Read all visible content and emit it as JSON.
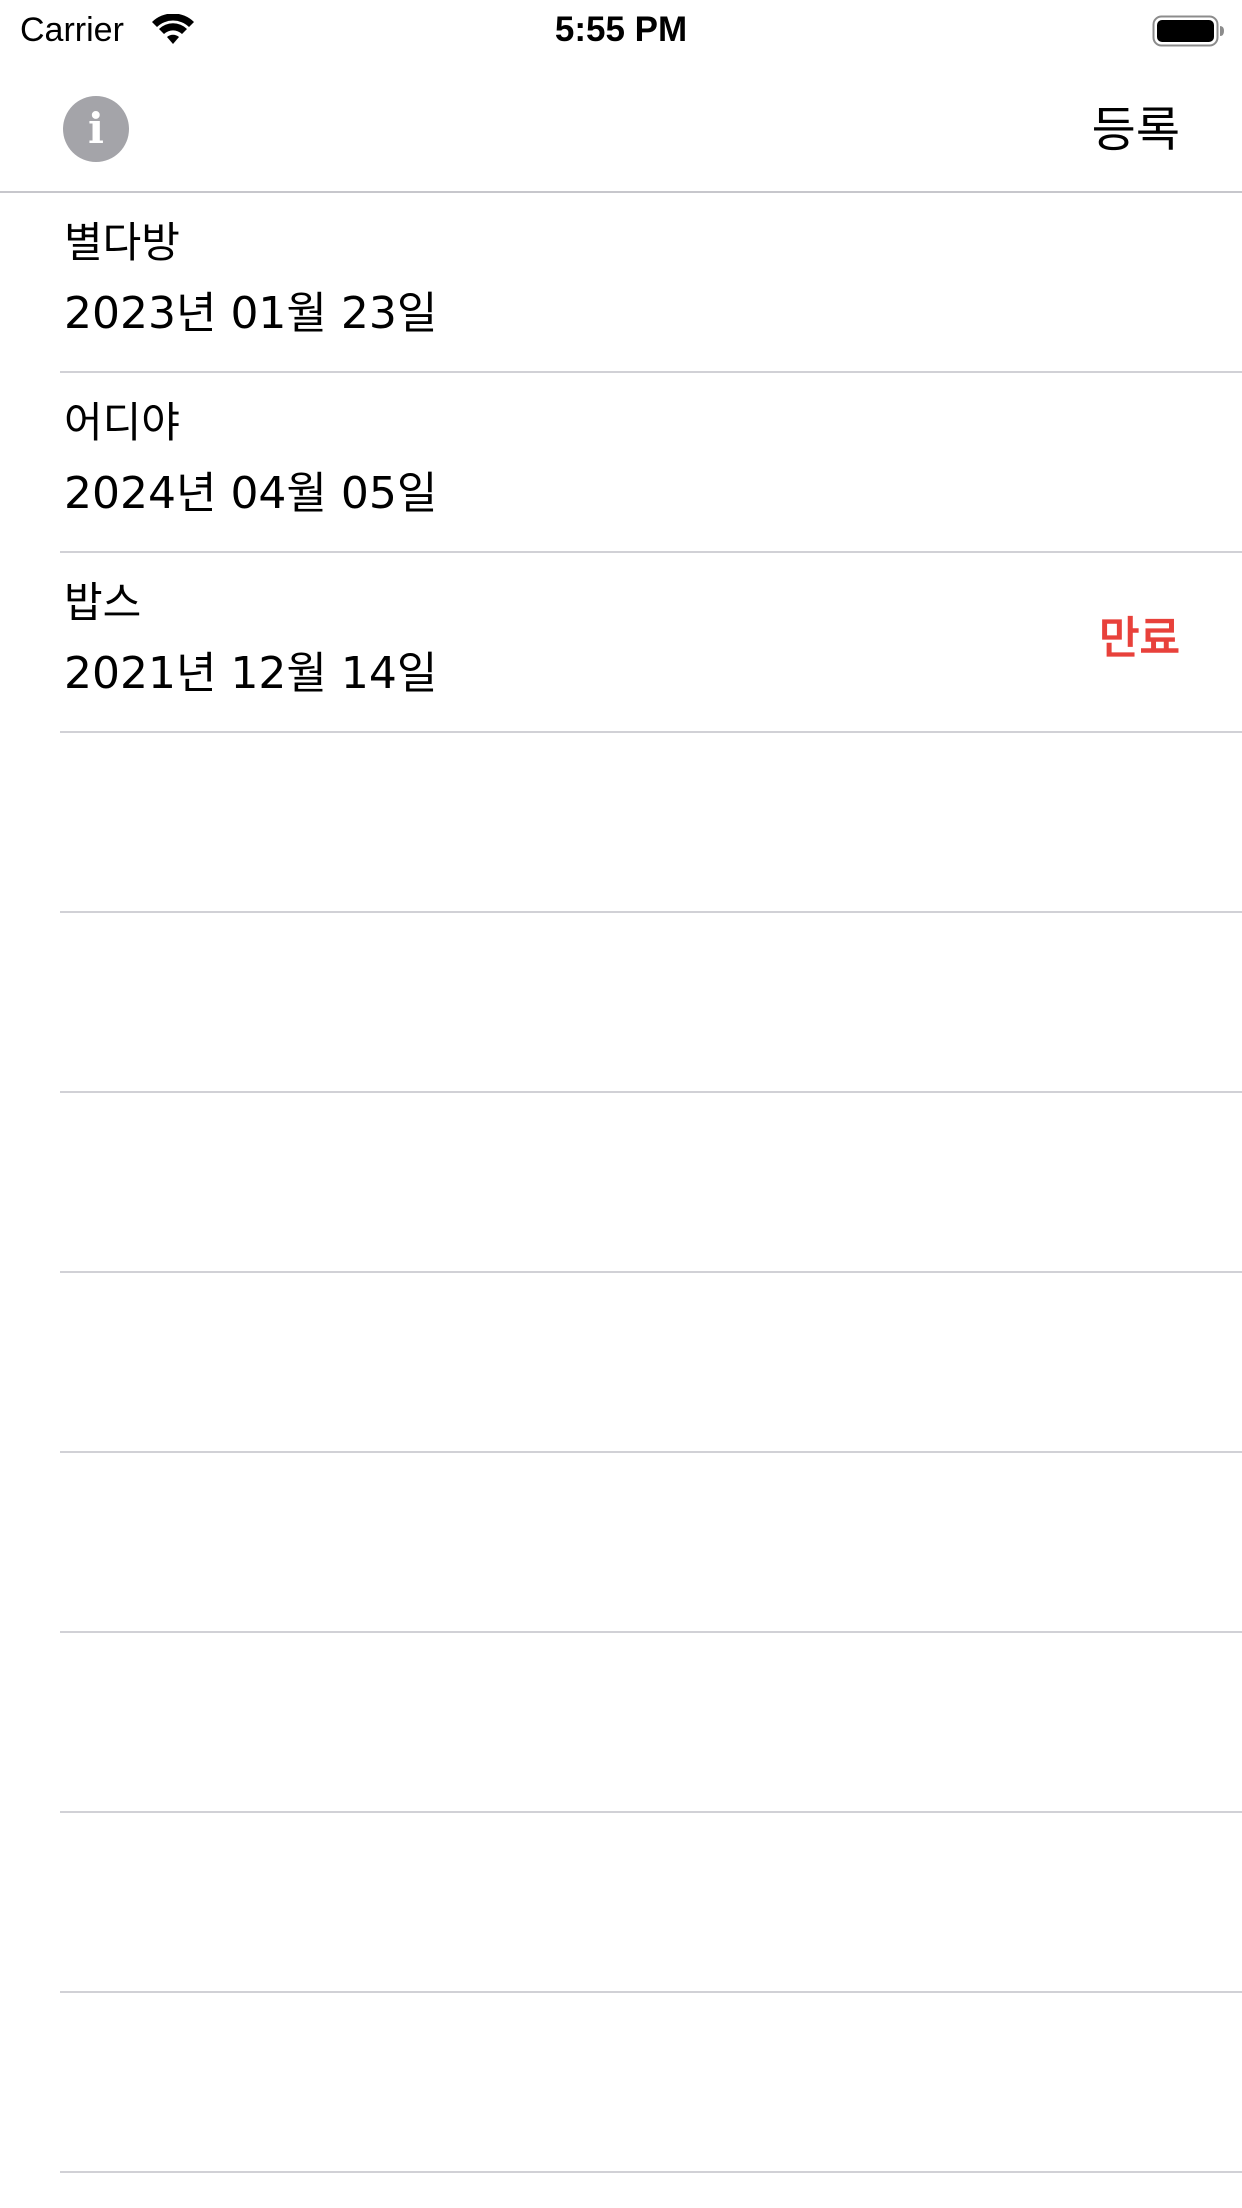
{
  "status_bar": {
    "carrier": "Carrier",
    "time": "5:55 PM",
    "icons": [
      "wifi-icon",
      "battery-icon"
    ]
  },
  "nav_bar": {
    "left_icon": "info-icon",
    "left_glyph": "i",
    "right_button": "등록"
  },
  "list": {
    "items": [
      {
        "title": "별다방",
        "date": "2023년 01월 23일",
        "status": ""
      },
      {
        "title": "어디야",
        "date": "2024년 04월 05일",
        "status": ""
      },
      {
        "title": "밥스",
        "date": "2021년 12월 14일",
        "status": "만료"
      }
    ]
  },
  "colors": {
    "expired": "#e8413b",
    "info_icon": "#a4a4a9",
    "separator": "#d1d1d6"
  }
}
